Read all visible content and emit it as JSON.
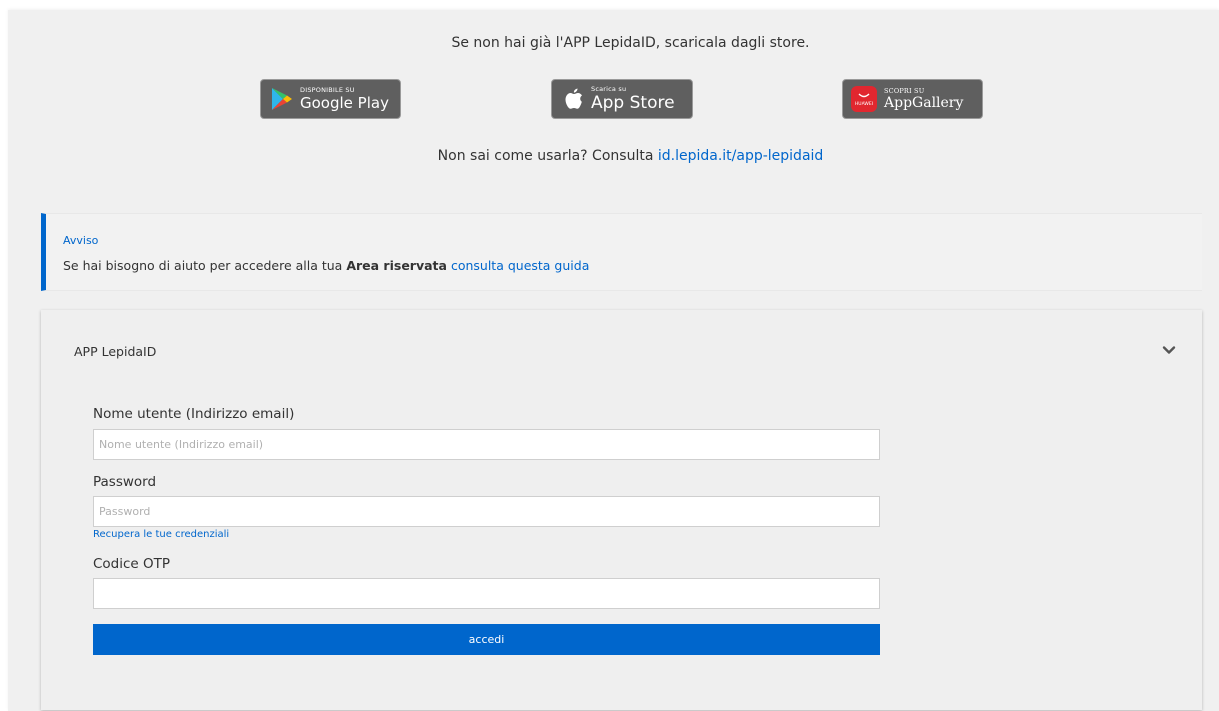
{
  "intro": {
    "text": "Se non hai già l'APP LepidaID, scaricala dagli store."
  },
  "stores": {
    "google": {
      "small": "DISPONIBILE SU",
      "big": "Google Play"
    },
    "apple": {
      "small": "Scarica su",
      "big": "App Store"
    },
    "huawei": {
      "small": "SCOPRI SU",
      "big": "AppGallery",
      "logo_text": "HUAWEI"
    }
  },
  "howto": {
    "prefix": "Non sai come usarla? Consulta ",
    "link": "id.lepida.it/app-lepidaid"
  },
  "notice": {
    "title": "Avviso",
    "text_before": "Se hai bisogno di aiuto per accedere alla tua ",
    "bold": "Area riservata",
    "link": "consulta questa guida"
  },
  "panel": {
    "title": "APP LepidaID",
    "username": {
      "label": "Nome utente (Indirizzo email)",
      "placeholder": "Nome utente (Indirizzo email)",
      "value": ""
    },
    "password": {
      "label": "Password",
      "placeholder": "Password",
      "value": ""
    },
    "recover_link": "Recupera le tue credenziali",
    "otp": {
      "label": "Codice OTP",
      "placeholder": "",
      "value": ""
    },
    "submit_label": "accedi"
  },
  "colors": {
    "accent": "#0066cc",
    "badge_bg": "#5f5f5f",
    "page_bg": "#f0f0f0",
    "huawei_red": "#e1272f"
  }
}
